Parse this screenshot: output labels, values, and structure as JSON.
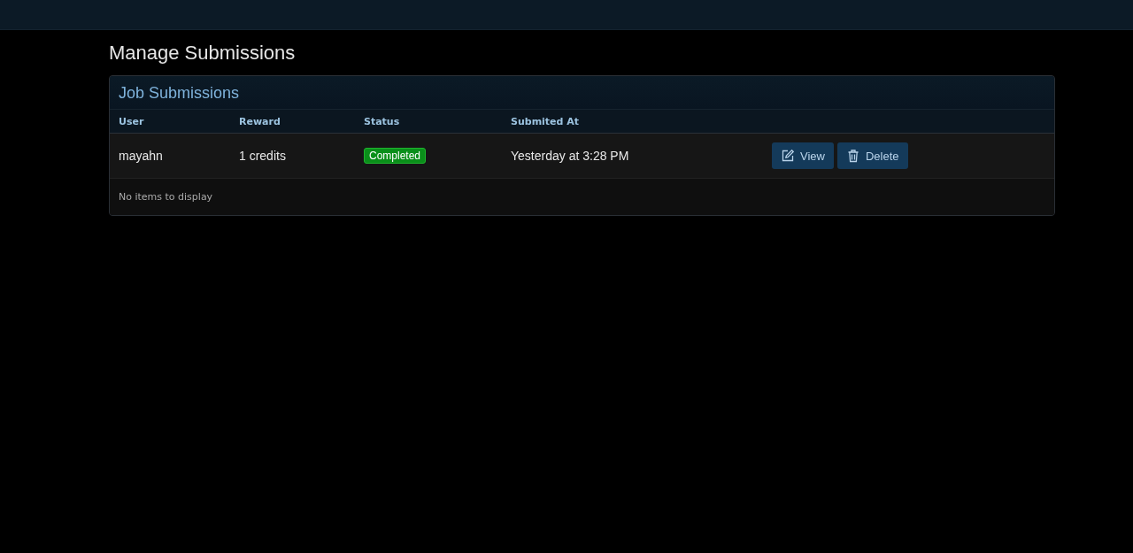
{
  "page_title": "Manage Submissions",
  "card": {
    "title": "Job Submissions",
    "columns": [
      "User",
      "Reward",
      "Status",
      "Submited At"
    ],
    "rows": [
      {
        "user": "mayahn",
        "reward": "1 credits",
        "status": {
          "label": "Completed",
          "kind": "success"
        },
        "submitted_at": "Yesterday at 3:28 PM",
        "actions": [
          {
            "kind": "edit",
            "label": "View"
          },
          {
            "kind": "delete",
            "label": "Delete"
          }
        ]
      }
    ],
    "footer": "No items to display"
  }
}
